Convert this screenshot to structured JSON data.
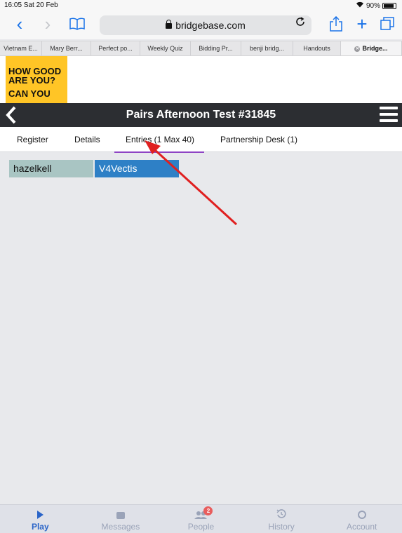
{
  "status_bar": {
    "time": "16:05 Sat 20 Feb",
    "wifi_icon": "wifi-icon",
    "battery": "90%"
  },
  "browser": {
    "url": "bridgebase.com",
    "icons": {
      "back": "‹",
      "forward": "›",
      "bookmarks": "book-icon",
      "reload": "C",
      "share": "share-icon",
      "new_tab": "+",
      "tabs": "tabs-icon"
    },
    "bookmarks": [
      {
        "label": "Vietnam E..."
      },
      {
        "label": "Mary Berr..."
      },
      {
        "label": "Perfect po..."
      },
      {
        "label": "Weekly Quiz"
      },
      {
        "label": "Bidding Pr..."
      },
      {
        "label": "benji bridg..."
      },
      {
        "label": "Handouts"
      },
      {
        "label": "Bridge..."
      }
    ]
  },
  "ad": {
    "line1": "HOW GOOD",
    "line2": "ARE YOU?",
    "line3": "CAN YOU"
  },
  "header": {
    "title": "Pairs Afternoon Test #31845",
    "back_icon": "back-chevron-icon",
    "menu_icon": "hamburger-icon"
  },
  "tabs": [
    {
      "label": "Register"
    },
    {
      "label": "Details"
    },
    {
      "label": "Entries (1 Max 40)",
      "active": true
    },
    {
      "label": "Partnership Desk (1)"
    }
  ],
  "entries": [
    {
      "player1": "hazelkell",
      "player2": "V4Vectis"
    }
  ],
  "annotation": {
    "color": "#e02020"
  },
  "bottom_nav": [
    {
      "label": "Play",
      "icon": "play-icon",
      "active": true
    },
    {
      "label": "Messages",
      "icon": "messages-icon"
    },
    {
      "label": "People",
      "icon": "people-icon",
      "badge": "2"
    },
    {
      "label": "History",
      "icon": "history-icon"
    },
    {
      "label": "Account",
      "icon": "account-icon"
    }
  ],
  "colors": {
    "header_bg": "#2c2e32",
    "active_tab_underline": "#8e44c4",
    "entry_partner_bg": "#a9c5c3",
    "entry_player_bg": "#2e80c6",
    "ad_bg": "#ffc526",
    "nav_active": "#2a64c8"
  }
}
